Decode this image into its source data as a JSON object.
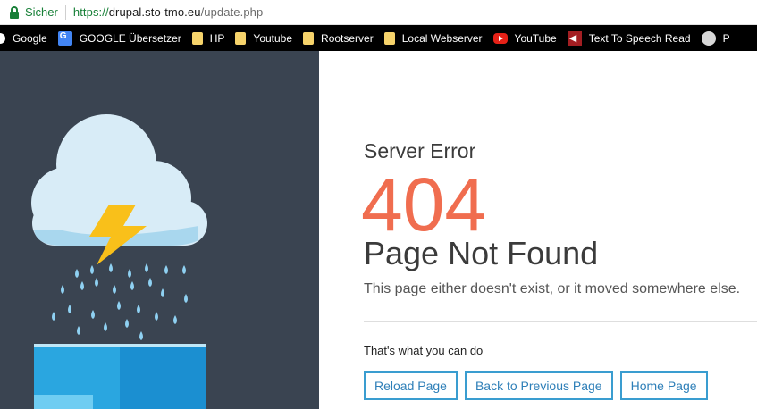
{
  "browser": {
    "secure_label": "Sicher",
    "url_protocol": "https://",
    "url_host": "drupal.sto-tmo.eu",
    "url_path": "/update.php"
  },
  "bookmarks": [
    {
      "label": "Google",
      "icon": "google-icon"
    },
    {
      "label": "GOOGLE Übersetzer",
      "icon": "translate-icon"
    },
    {
      "label": "HP",
      "icon": "folder-icon"
    },
    {
      "label": "Youtube",
      "icon": "folder-icon"
    },
    {
      "label": "Rootserver",
      "icon": "folder-icon"
    },
    {
      "label": "Local Webserver",
      "icon": "folder-icon"
    },
    {
      "label": "YouTube",
      "icon": "youtube-icon"
    },
    {
      "label": "Text To Speech Read",
      "icon": "speaker-icon"
    },
    {
      "label": "P",
      "icon": "extension-icon"
    }
  ],
  "error": {
    "eyebrow": "Server Error",
    "code": "404",
    "title": "Page Not Found",
    "description": "This page either doesn't exist, or it moved somewhere else."
  },
  "actions": {
    "title": "That's what you can do",
    "buttons": [
      "Reload Page",
      "Back to Previous Page",
      "Home Page"
    ]
  },
  "colors": {
    "left_panel": "#3a4451",
    "accent": "#f06d4f",
    "button_border": "#3a9dd0",
    "secure_green": "#188038"
  }
}
